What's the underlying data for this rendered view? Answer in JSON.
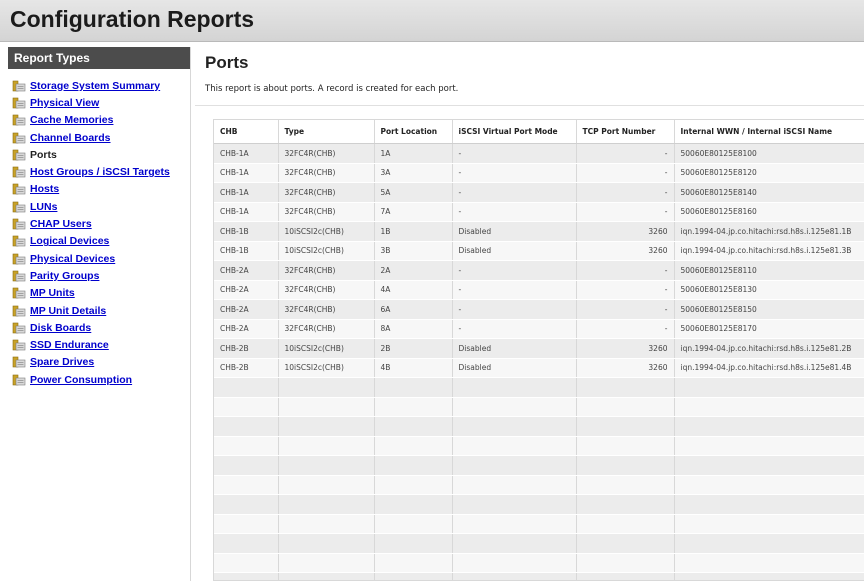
{
  "app": {
    "title": "Configuration Reports"
  },
  "sidebar": {
    "header": "Report Types",
    "items": [
      {
        "label": "Storage System Summary",
        "link": true
      },
      {
        "label": "Physical View",
        "link": true
      },
      {
        "label": "Cache Memories",
        "link": true
      },
      {
        "label": "Channel Boards",
        "link": true
      },
      {
        "label": "Ports",
        "link": false
      },
      {
        "label": "Host Groups / iSCSI Targets",
        "link": true
      },
      {
        "label": "Hosts",
        "link": true
      },
      {
        "label": "LUNs",
        "link": true
      },
      {
        "label": "CHAP Users",
        "link": true
      },
      {
        "label": "Logical Devices",
        "link": true
      },
      {
        "label": "Physical Devices",
        "link": true
      },
      {
        "label": "Parity Groups",
        "link": true
      },
      {
        "label": "MP Units",
        "link": true
      },
      {
        "label": "MP Unit Details",
        "link": true
      },
      {
        "label": "Disk Boards",
        "link": true
      },
      {
        "label": "SSD Endurance",
        "link": true
      },
      {
        "label": "Spare Drives",
        "link": true
      },
      {
        "label": "Power Consumption",
        "link": true
      }
    ],
    "icon": "report-folder-icon"
  },
  "main": {
    "title": "Ports",
    "description": "This report is about ports. A record is created for each port.",
    "table": {
      "columns": [
        "CHB",
        "Type",
        "Port Location",
        "iSCSI Virtual Port Mode",
        "TCP Port Number",
        "Internal WWN / Internal iSCSI Name"
      ],
      "rows": [
        [
          "CHB-1A",
          "32FC4R(CHB)",
          "1A",
          "-",
          "-",
          "50060E80125E8100"
        ],
        [
          "CHB-1A",
          "32FC4R(CHB)",
          "3A",
          "-",
          "-",
          "50060E80125E8120"
        ],
        [
          "CHB-1A",
          "32FC4R(CHB)",
          "5A",
          "-",
          "-",
          "50060E80125E8140"
        ],
        [
          "CHB-1A",
          "32FC4R(CHB)",
          "7A",
          "-",
          "-",
          "50060E80125E8160"
        ],
        [
          "CHB-1B",
          "10iSCSI2c(CHB)",
          "1B",
          "Disabled",
          "3260",
          "iqn.1994-04.jp.co.hitachi:rsd.h8s.i.125e81.1B"
        ],
        [
          "CHB-1B",
          "10iSCSI2c(CHB)",
          "3B",
          "Disabled",
          "3260",
          "iqn.1994-04.jp.co.hitachi:rsd.h8s.i.125e81.3B"
        ],
        [
          "CHB-2A",
          "32FC4R(CHB)",
          "2A",
          "-",
          "-",
          "50060E80125E8110"
        ],
        [
          "CHB-2A",
          "32FC4R(CHB)",
          "4A",
          "-",
          "-",
          "50060E80125E8130"
        ],
        [
          "CHB-2A",
          "32FC4R(CHB)",
          "6A",
          "-",
          "-",
          "50060E80125E8150"
        ],
        [
          "CHB-2A",
          "32FC4R(CHB)",
          "8A",
          "-",
          "-",
          "50060E80125E8170"
        ],
        [
          "CHB-2B",
          "10iSCSI2c(CHB)",
          "2B",
          "Disabled",
          "3260",
          "iqn.1994-04.jp.co.hitachi:rsd.h8s.i.125e81.2B"
        ],
        [
          "CHB-2B",
          "10iSCSI2c(CHB)",
          "4B",
          "Disabled",
          "3260",
          "iqn.1994-04.jp.co.hitachi:rsd.h8s.i.125e81.4B"
        ]
      ]
    }
  },
  "colors": {
    "link": "#0000cc",
    "header_bg": "#4c4c4c",
    "row_odd": "#ececec",
    "row_even": "#f7f7f7"
  }
}
